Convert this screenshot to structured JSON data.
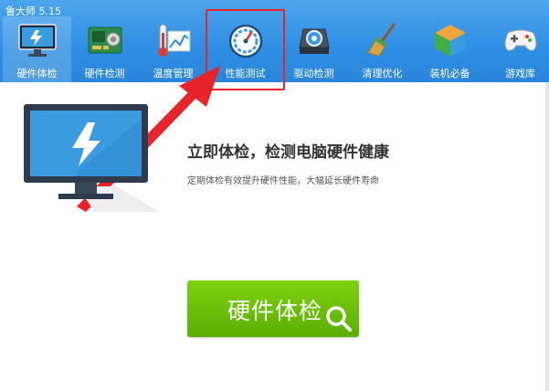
{
  "app": {
    "title": "鲁大师 5.15"
  },
  "tabs": [
    {
      "label": "硬件体检",
      "icon": "monitor-bolt-icon",
      "active": true
    },
    {
      "label": "硬件检测",
      "icon": "circuit-board-icon"
    },
    {
      "label": "温度管理",
      "icon": "thermometer-chart-icon"
    },
    {
      "label": "性能测试",
      "icon": "speedometer-icon"
    },
    {
      "label": "驱动检测",
      "icon": "gear-drive-icon"
    },
    {
      "label": "清理优化",
      "icon": "broom-icon"
    },
    {
      "label": "装机必备",
      "icon": "box-cube-icon"
    },
    {
      "label": "游戏库",
      "icon": "gamepad-icon"
    }
  ],
  "annotation": {
    "highlighted_tab": "性能测试",
    "color": "#e8232a"
  },
  "main": {
    "headline": "立即体检，检测电脑硬件健康",
    "subline": "定期体检有效提升硬件性能，大幅延长硬件寿命",
    "check_button_label": "硬件体检"
  },
  "colors": {
    "topbar": "#2d8ee3",
    "button": "#6cc10a",
    "annotation": "#e8232a"
  }
}
